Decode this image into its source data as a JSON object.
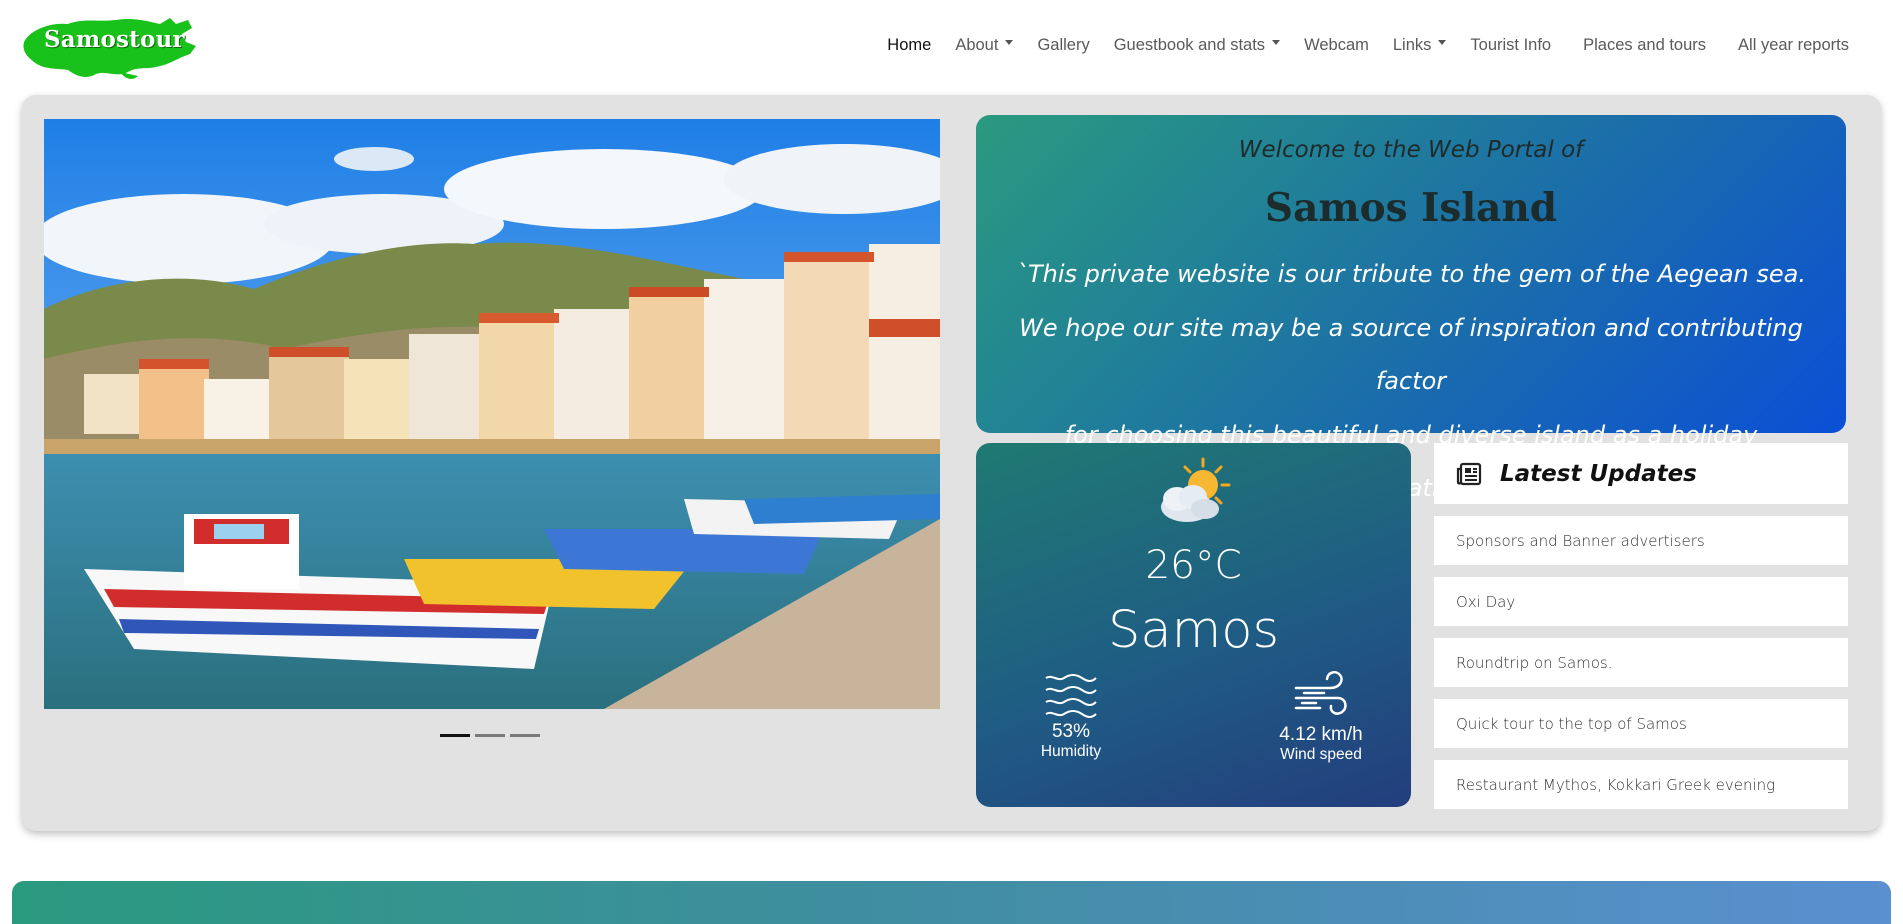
{
  "brand": {
    "logo_text": "Samostour",
    "logo_color": "#19c21a"
  },
  "nav": {
    "items": [
      {
        "label": "Home",
        "active": true,
        "dropdown": false
      },
      {
        "label": "About",
        "active": false,
        "dropdown": true
      },
      {
        "label": "Gallery",
        "active": false,
        "dropdown": false
      },
      {
        "label": "Guestbook and stats",
        "active": false,
        "dropdown": true
      },
      {
        "label": "Webcam",
        "active": false,
        "dropdown": false
      },
      {
        "label": "Links",
        "active": false,
        "dropdown": true
      },
      {
        "label": "Tourist Info",
        "active": false,
        "dropdown": false
      },
      {
        "label": "Places and tours",
        "active": false,
        "dropdown": false
      },
      {
        "label": "All year reports",
        "active": false,
        "dropdown": false
      }
    ]
  },
  "carousel": {
    "slides": 3,
    "active_slide": 1
  },
  "welcome": {
    "subtitle": "Welcome to the Web Portal of",
    "title": "Samos Island",
    "quote_line1": "`This private website is our tribute to the gem of the Aegean sea.",
    "quote_line2": "We hope our site may be a source of inspiration and contributing factor",
    "quote_line3": "for choosing this beautiful and diverse island as a holiday destination.`"
  },
  "weather": {
    "icon": "partly-cloudy-icon",
    "temperature": "26°C",
    "city": "Samos",
    "humidity_value": "53%",
    "humidity_label": "Humidity",
    "wind_value": "4.12 km/h",
    "wind_label": "Wind speed"
  },
  "updates": {
    "heading": "Latest Updates",
    "icon": "newspaper-icon",
    "items": [
      "Sponsors and Banner advertisers",
      "Oxi Day",
      "Roundtrip on Samos.",
      "Quick tour to the top of Samos",
      "Restaurant Mythos, Kokkari Greek evening"
    ]
  },
  "colors": {
    "accent_teal": "#2a9a7f",
    "accent_blue": "#0b4fd6",
    "hero_bg": "#e2e2e2"
  }
}
